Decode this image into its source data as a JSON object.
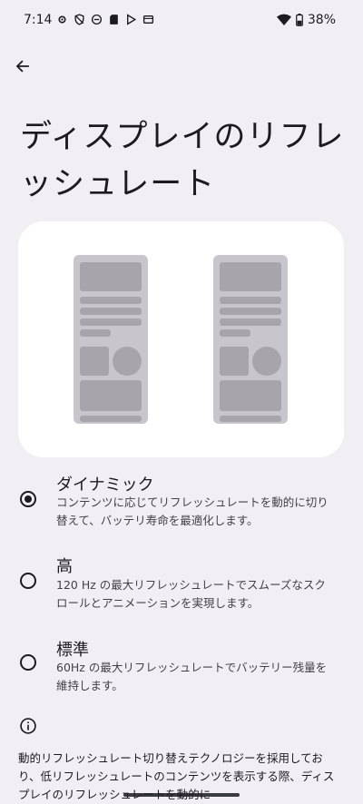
{
  "status_bar": {
    "time": "7:14",
    "battery": "38%"
  },
  "page": {
    "title": "ディスプレイのリフレッシュレート"
  },
  "options": [
    {
      "title": "ダイナミック",
      "description": "コンテンツに応じてリフレッシュレートを動的に切り替えて、バッテリ寿命を最適化します。",
      "selected": true
    },
    {
      "title": "高",
      "description": "120 Hz の最大リフレッシュレートでスムーズなスクロールとアニメーションを実現します。",
      "selected": false
    },
    {
      "title": "標準",
      "description": "60Hz の最大リフレッシュレートでバッテリー残量を維持します。",
      "selected": false
    }
  ],
  "footer": {
    "text": "動的リフレッシュレート切り替えテクノロジーを採用しており、低リフレッシュレートのコンテンツを表示する際、ディスプレイのリフレッシュレートを動的に"
  },
  "icons": {
    "back": "arrow-back-icon",
    "info": "info-icon"
  }
}
